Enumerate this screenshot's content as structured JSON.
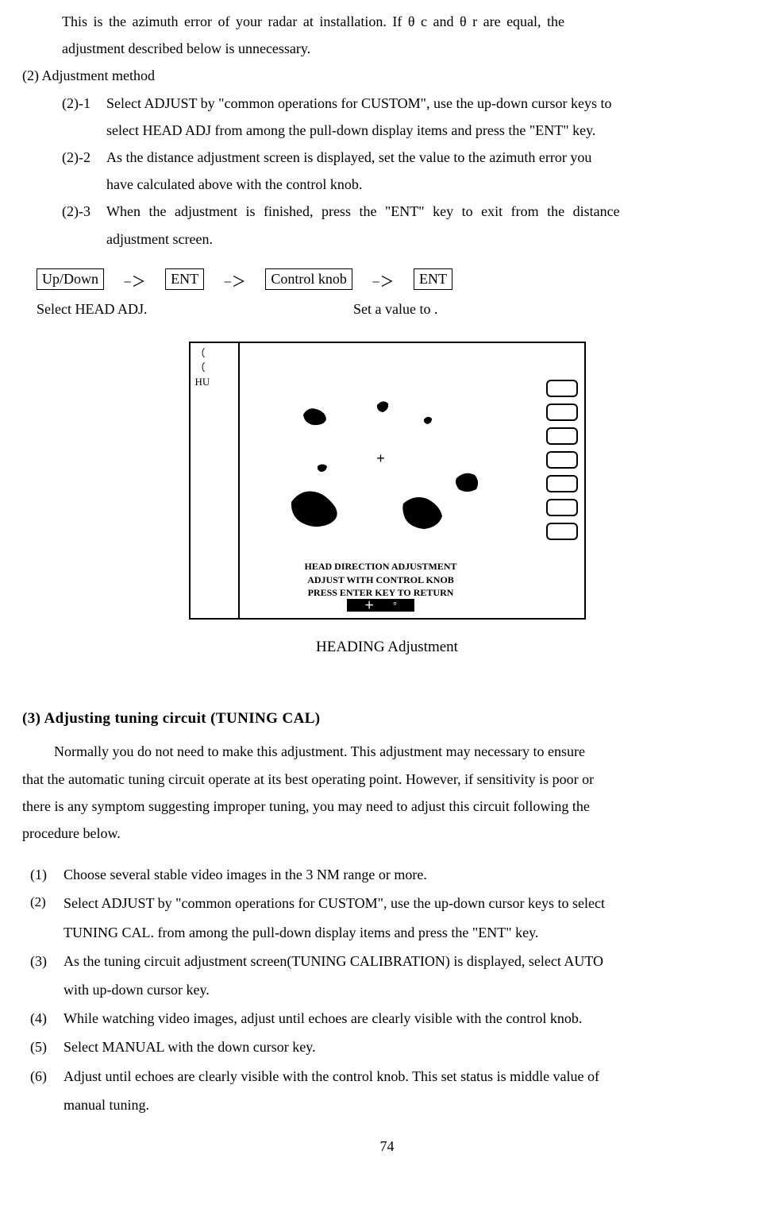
{
  "page_number": "74",
  "top": {
    "para1a": "This is the azimuth error of your radar at installation. If θ  c and θ  r are equal, the",
    "para1b": "adjustment described below is unnecessary."
  },
  "adjustment_method": {
    "heading": "(2) Adjustment method",
    "item21_label": "(2)-1",
    "item21_line1": "Select ADJUST by \"common operations for CUSTOM\", use the up-down cursor keys to",
    "item21_line2": "select HEAD ADJ from among the pull-down display items and press the \"ENT\" key.",
    "item22_label": "(2)-2",
    "item22_line1": "As the distance adjustment screen is displayed, set the value to the azimuth error you",
    "item22_line2": "have calculated above with the control knob.",
    "item23_label": "(2)-3",
    "item23_line1": "When the adjustment is finished, press the \"ENT\" key to exit from the distance",
    "item23_line2": "adjustment screen."
  },
  "flow": {
    "step1": "Up/Down",
    "step2": "ENT",
    "step3": "Control knob",
    "step4": "ENT",
    "arrow": "−＞",
    "cap1": "Select HEAD ADJ.",
    "cap2": "Set a value to ."
  },
  "radar": {
    "left_small1": "（",
    "left_small2": "（",
    "left_label": "HU",
    "overlay1": "HEAD DIRECTION ADJUSTMENT",
    "overlay2": "ADJUST WITH CONTROL KNOB",
    "overlay3": "PRESS ENTER KEY TO RETURN",
    "overlay_value": "＋　　°",
    "caption": "HEADING Adjustment"
  },
  "section3": {
    "heading": "(3) Adjusting tuning circuit (TUNING CAL)",
    "p1": "Normally you do not need to make this adjustment. This adjustment may necessary to ensure",
    "p2": "that the automatic tuning circuit operate at its best operating point. However, if sensitivity is poor or",
    "p3": "there is any symptom suggesting improper tuning, you may need to adjust this circuit following the",
    "p4": "procedure below.",
    "items": {
      "n1": "(1)",
      "t1": "Choose several stable video images in the 3 NM range or more.",
      "n2": "(2)",
      "t2a": "Select ADJUST by \"common operations for CUSTOM\", use the up-down cursor keys to select",
      "t2b": "TUNING CAL. from among the pull-down display items and press the \"ENT\" key.",
      "n3": "(3)",
      "t3a": "As the tuning circuit adjustment screen(TUNING CALIBRATION) is displayed, select AUTO",
      "t3b": "with up-down cursor key.",
      "n4": "(4)",
      "t4": "While watching video images, adjust until echoes are clearly visible with the control knob.",
      "n5": "(5)",
      "t5": "Select MANUAL with the down cursor key.",
      "n6": "(6)",
      "t6a": "Adjust until echoes are clearly visible with the control knob. This set status is middle value of",
      "t6b": "manual tuning."
    }
  }
}
